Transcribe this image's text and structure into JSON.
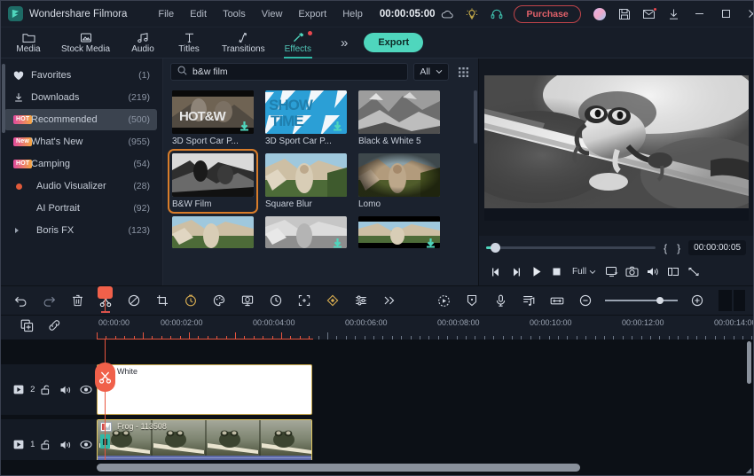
{
  "window": {
    "app_title": "Wondershare Filmora",
    "menus": [
      "File",
      "Edit",
      "Tools",
      "View",
      "Export",
      "Help"
    ],
    "project_time": "00:00:05:00",
    "purchase_label": "Purchase",
    "title_icons": [
      "cloud-icon",
      "bulb-icon",
      "headphone-icon",
      "avatar",
      "save-icon",
      "mail-icon",
      "download-icon"
    ],
    "controls": [
      "minimize",
      "maximize",
      "close"
    ]
  },
  "tabbar": {
    "tabs": [
      {
        "label": "Media",
        "icon": "folder-icon",
        "active": false,
        "dot": false
      },
      {
        "label": "Stock Media",
        "icon": "stock-media-icon",
        "active": false,
        "dot": false
      },
      {
        "label": "Audio",
        "icon": "music-note-icon",
        "active": false,
        "dot": false
      },
      {
        "label": "Titles",
        "icon": "text-t-icon",
        "active": false,
        "dot": false
      },
      {
        "label": "Transitions",
        "icon": "transition-arrow-icon",
        "active": false,
        "dot": false
      },
      {
        "label": "Effects",
        "icon": "magic-wand-icon",
        "active": true,
        "dot": true
      }
    ],
    "more_label": "»",
    "export_label": "Export"
  },
  "sidebar": {
    "items": [
      {
        "label": "Favorites",
        "count": "(1)",
        "badge": "",
        "icon": "heart-icon",
        "active": false
      },
      {
        "label": "Downloads",
        "count": "(219)",
        "badge": "",
        "icon": "download-icon",
        "active": false
      },
      {
        "label": "Recommended",
        "count": "(500)",
        "badge": "HOT",
        "icon": "",
        "active": true
      },
      {
        "label": "What's New",
        "count": "(955)",
        "badge": "New",
        "icon": "",
        "active": false
      },
      {
        "label": "Camping",
        "count": "(54)",
        "badge": "HOT",
        "icon": "",
        "active": false
      },
      {
        "label": "Audio Visualizer",
        "count": "(28)",
        "badge": "",
        "icon": "red-dot-icon",
        "active": false
      },
      {
        "label": "AI Portrait",
        "count": "(92)",
        "badge": "",
        "icon": "",
        "active": false
      },
      {
        "label": "Boris FX",
        "count": "(123)",
        "badge": "",
        "icon": "expand-arrow-icon",
        "active": false
      }
    ]
  },
  "browser": {
    "search": {
      "value": "b&w film",
      "placeholder": "Search",
      "icon": "search-icon"
    },
    "filter": {
      "value": "All",
      "icon": "chevron-down-icon"
    },
    "view_toggle_icon": "grid-view-icon",
    "effects": [
      {
        "name": "3D Sport Car P...",
        "selected": false,
        "downloadable": true,
        "style": "sportcar1"
      },
      {
        "name": "3D Sport Car P...",
        "selected": false,
        "downloadable": true,
        "style": "showtime"
      },
      {
        "name": "Black & White 5",
        "selected": false,
        "downloadable": false,
        "style": "bw-mountain"
      },
      {
        "name": "B&W Film",
        "selected": true,
        "downloadable": false,
        "style": "bw-vine"
      },
      {
        "name": "Square Blur",
        "selected": false,
        "downloadable": false,
        "style": "vine"
      },
      {
        "name": "Lomo",
        "selected": false,
        "downloadable": false,
        "style": "vine-warm"
      },
      {
        "name": "",
        "selected": false,
        "downloadable": false,
        "style": "vine"
      },
      {
        "name": "",
        "selected": false,
        "downloadable": true,
        "style": "bw-vine2"
      },
      {
        "name": "",
        "selected": false,
        "downloadable": true,
        "style": "vine-letterbox"
      }
    ]
  },
  "preview": {
    "timecode": "00:00:00:05",
    "quality": "Full",
    "in_marker": "{",
    "out_marker": "}",
    "buttons": [
      "prev-frame",
      "next-frame",
      "play",
      "stop",
      "quality",
      "screen-icon",
      "snapshot-icon",
      "volume-icon",
      "split-screen-icon",
      "fullscreen-icon"
    ]
  },
  "edit_toolbar": {
    "left_tools": [
      "undo-icon",
      "redo-icon",
      "delete-icon",
      "split-scissors-icon",
      "mask-icon",
      "crop-icon",
      "speed-icon",
      "color-icon",
      "green-screen-icon",
      "stabilize-icon",
      "auto-reframe-icon",
      "keyframe-icon",
      "adjust-sliders-icon",
      "more-chevrons-icon"
    ],
    "right_tools": [
      "render-preview-icon",
      "marker-icon",
      "voiceover-icon",
      "audio-mixer-icon",
      "fit-timeline-icon"
    ],
    "zoom_out_icon": "zoom-out-icon",
    "zoom_in_icon": "zoom-in-icon",
    "panel_toggle_icon": "panel-toggle-icon"
  },
  "timeline": {
    "left_tools": [
      "add-to-project-icon",
      "link-icon"
    ],
    "ruler_labels": [
      "00:00:00",
      "00:00:02:00",
      "00:00:04:00",
      "00:00:06:00",
      "00:00:08:00",
      "00:00:10:00",
      "00:00:12:00",
      "00:00:14:00"
    ],
    "playhead_icon": "scissors-cursor-icon",
    "tracks": [
      {
        "number": "2",
        "icons": [
          "track-video-icon",
          "lock-icon",
          "mute-icon",
          "eye-icon"
        ],
        "clip": {
          "label": "White",
          "type": "white-background",
          "has_fx_badge": false
        }
      },
      {
        "number": "1",
        "icons": [
          "track-video-icon",
          "lock-icon",
          "mute-icon",
          "eye-icon"
        ],
        "clip": {
          "label": "Frog - 113508",
          "type": "video",
          "has_fx_badge": true
        }
      }
    ]
  }
}
